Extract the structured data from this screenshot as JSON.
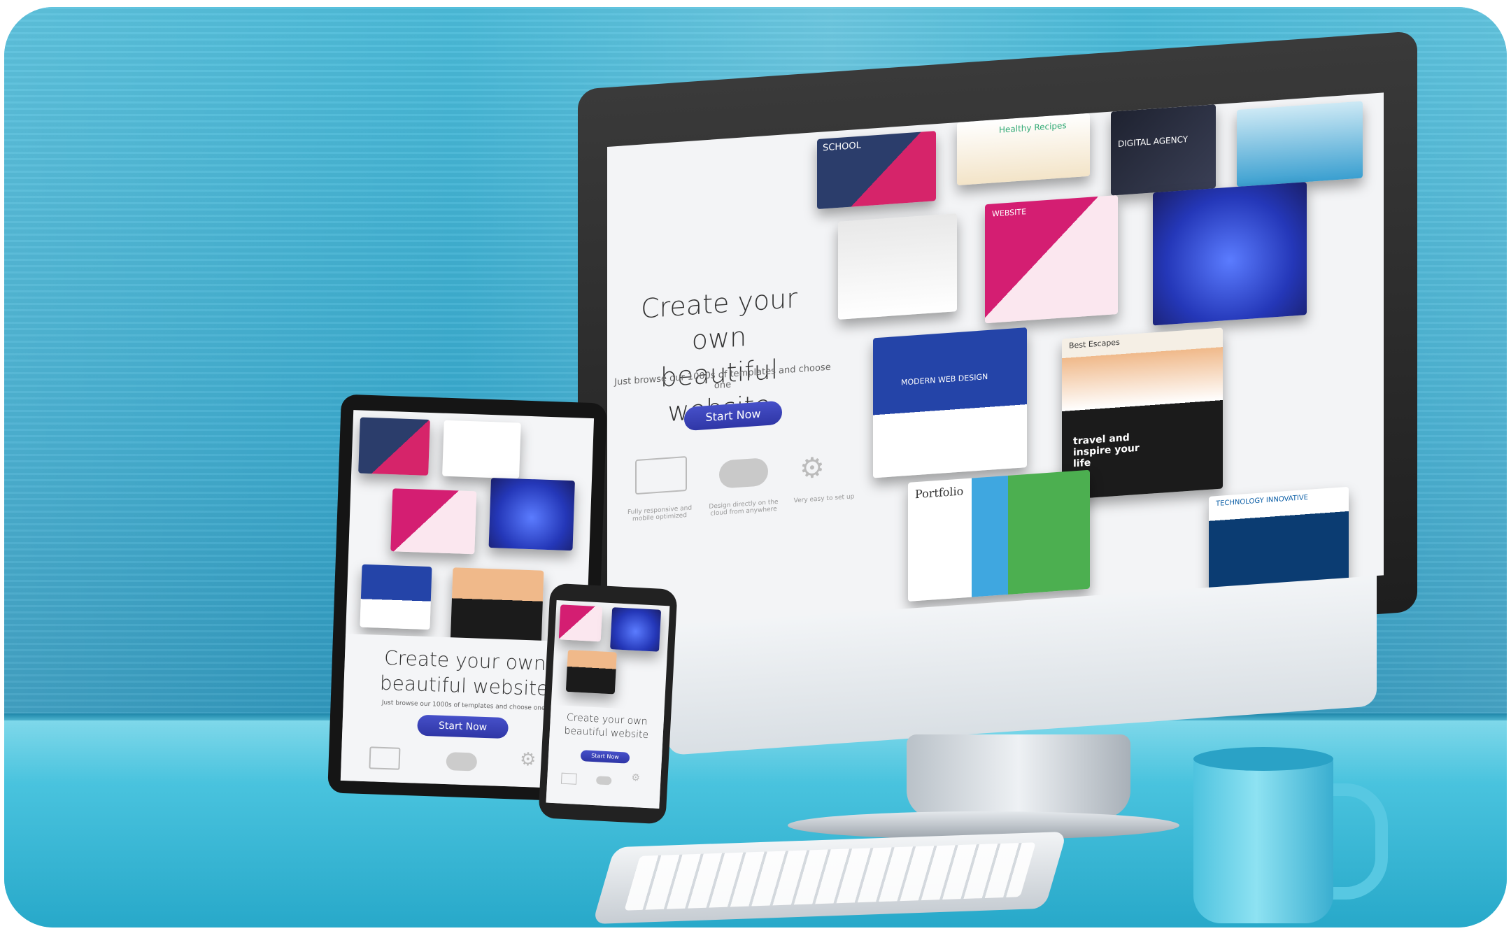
{
  "monitor": {
    "title_line1": "Create your own",
    "title_line2": "beautiful website",
    "subtitle": "Just browse our 1000s of templates and choose one",
    "button": "Start Now",
    "features": [
      {
        "icon": "devices-icon",
        "text": "Fully responsive and mobile optimized"
      },
      {
        "icon": "cloud-icon",
        "text": "Design directly on the cloud from anywhere"
      },
      {
        "icon": "gears-icon",
        "text": "Very easy to set up"
      }
    ],
    "tiles": [
      "SCHOOL",
      "Healthy Recipes",
      "DIGITAL AGENCY",
      "WEBSITE",
      "MODERN WEB DESIGN",
      "Best Escapes",
      "travel and inspire your life",
      "Portfolio",
      "TECHNOLOGY INNOVATIVE"
    ]
  },
  "tablet": {
    "title_line1": "Create your own",
    "title_line2": "beautiful website",
    "subtitle": "Just browse our 1000s of templates and choose one",
    "button": "Start Now"
  },
  "phone": {
    "title_line1": "Create your own",
    "title_line2": "beautiful website",
    "button": "Start Now"
  },
  "colors": {
    "wall": "#38a8cc",
    "button": "#3a40b8",
    "mug": "#5cc6e0"
  }
}
